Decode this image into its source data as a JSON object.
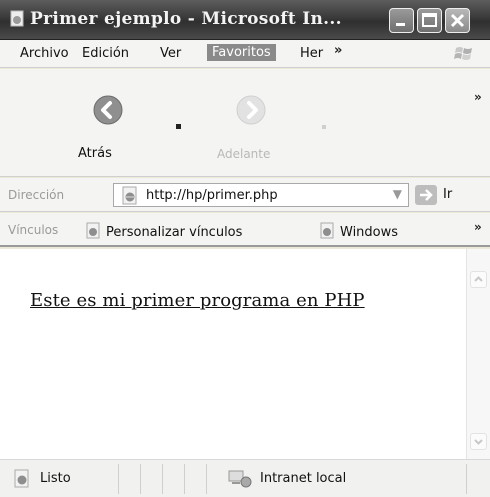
{
  "window": {
    "title": "Primer ejemplo - Microsoft In..."
  },
  "menu": {
    "items": [
      "Archivo",
      "Edición",
      "Ver",
      "Favoritos",
      "Her"
    ],
    "overflow": "»"
  },
  "toolbar": {
    "back_label": "Atrás",
    "forward_label": "Adelante",
    "overflow": "»"
  },
  "address": {
    "label": "Dirección",
    "url": "http://hp/primer.php",
    "go_label": "Ir"
  },
  "links": {
    "label": "Vínculos",
    "items": [
      "Personalizar vínculos",
      "Windows"
    ],
    "overflow": "»"
  },
  "page": {
    "text": "Este es mi primer programa en PHP"
  },
  "status": {
    "text": "Listo",
    "zone": "Intranet local"
  }
}
